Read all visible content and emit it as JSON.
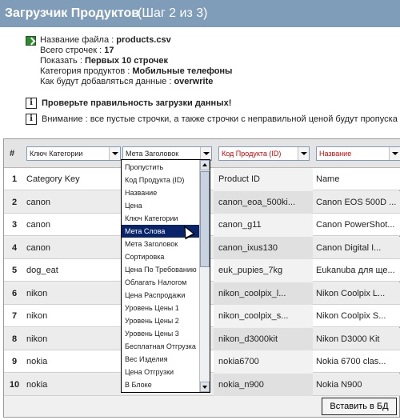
{
  "title": {
    "main": "Загрузчик Продуктов",
    "step": "(Шаг 2 из 3)"
  },
  "info": {
    "filename_label": "Название файла :",
    "filename_value": "products.csv",
    "total_label": "Всего строчек :",
    "total_value": "17",
    "show_label": "Показать :",
    "show_value": "Первых 10 строчек",
    "category_label": "Категория продуктов :",
    "category_value": "Мобильные телефоны",
    "mode_label": "Как будут добавляться данные :",
    "mode_value": "overwrite"
  },
  "notices": {
    "check": "Проверьте правильность загрузки данных!",
    "warning": "Внимание : все пустые строчки, а также строчки с неправильной ценой будут пропуска"
  },
  "table": {
    "hash_header": "#",
    "selects": [
      "Ключ Категории",
      "Мета Заголовок",
      "Код Продукта (ID)",
      "Название"
    ],
    "rows": [
      {
        "n": "1",
        "c1": "Category Key",
        "c2": "Product ID",
        "c3": "Name"
      },
      {
        "n": "2",
        "c1": "canon",
        "c2": "canon_eoa_500ki...",
        "c3": "Canon EOS 500D ..."
      },
      {
        "n": "3",
        "c1": "canon",
        "c2": "canon_g11",
        "c3": "Canon PowerShot..."
      },
      {
        "n": "4",
        "c1": "canon",
        "c2": "canon_ixus130",
        "c3": "Canon Digital I..."
      },
      {
        "n": "5",
        "c1": "dog_eat",
        "c2": "euk_pupies_7kg",
        "c3": "Eukanuba для ще..."
      },
      {
        "n": "6",
        "c1": "nikon",
        "c2": "nikon_coolpix_l...",
        "c3": "Nikon Coolpix L..."
      },
      {
        "n": "7",
        "c1": "nikon",
        "c2": "nikon_coolpix_s...",
        "c3": "Nikon Coolpix S..."
      },
      {
        "n": "8",
        "c1": "nikon",
        "c2": "nikon_d3000kit",
        "c3": "Nikon D3000 Kit"
      },
      {
        "n": "9",
        "c1": "nokia",
        "c2": "nokia6700",
        "c3": "Nokia 6700 clas..."
      },
      {
        "n": "10",
        "c1": "nokia",
        "c2": "nokia_n900",
        "c3": "Nokia N900"
      }
    ]
  },
  "dropdown": {
    "options": [
      "Пропустить",
      "Код Продукта (ID)",
      "Название",
      "Цена",
      "Ключ Категории",
      "Мета Слова",
      "Мета Заголовок",
      "Сортировка",
      "Цена По Требованию",
      "Облагать Налогом",
      "Цена Распродажи",
      "Уровень Цены 1",
      "Уровень Цены 2",
      "Уровень Цены 3",
      "Бесплатная Отгрузка",
      "Вес Изделия",
      "Цена Отгрузки",
      "В Блоке"
    ],
    "highlighted_index": 5
  },
  "buttons": {
    "save": "Вставить в БД"
  },
  "colors": {
    "titlebar": "#7f9db9",
    "highlight": "#0a246a",
    "red_select": "#d40000"
  }
}
